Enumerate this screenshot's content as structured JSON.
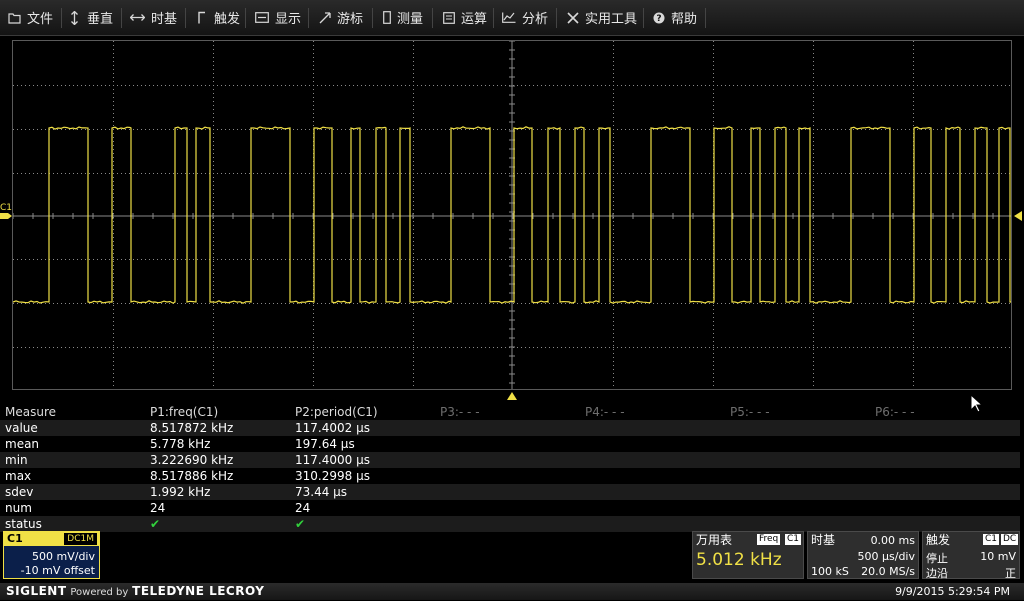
{
  "menu": {
    "items": [
      {
        "label": "文件",
        "icon": "folder-icon"
      },
      {
        "label": "垂直",
        "icon": "vertical-arrows-icon"
      },
      {
        "label": "时基",
        "icon": "horizontal-arrows-icon"
      },
      {
        "label": "触发",
        "icon": "trigger-edge-icon"
      },
      {
        "label": "显示",
        "icon": "display-icon"
      },
      {
        "label": "游标",
        "icon": "cursor-icon"
      },
      {
        "label": "测量",
        "icon": "measure-icon"
      },
      {
        "label": "运算",
        "icon": "math-icon"
      },
      {
        "label": "分析",
        "icon": "analysis-icon"
      },
      {
        "label": "实用工具",
        "icon": "tools-icon"
      },
      {
        "label": "帮助",
        "icon": "help-icon"
      }
    ]
  },
  "scope": {
    "channel_label": "C1",
    "trace_color": "#f0e046",
    "waveform_edges": [
      49,
      88,
      112,
      131,
      175,
      187,
      196,
      210,
      251,
      290,
      314,
      332,
      351,
      360,
      376,
      386,
      400,
      410,
      451,
      490,
      514,
      532,
      548,
      560,
      575,
      584,
      599,
      610,
      651,
      690,
      714,
      732,
      751,
      760,
      775,
      786,
      799,
      810,
      851,
      890,
      914,
      931,
      946,
      960,
      975,
      987,
      999,
      1010
    ]
  },
  "measure": {
    "header": [
      "Measure",
      "P1:freq(C1)",
      "P2:period(C1)",
      "P3:- - -",
      "P4:- - -",
      "P5:- - -",
      "P6:- - -"
    ],
    "rows": [
      {
        "label": "value",
        "p1": "8.517872 kHz",
        "p2": "117.4002 µs"
      },
      {
        "label": "mean",
        "p1": "5.778 kHz",
        "p2": "197.64 µs"
      },
      {
        "label": "min",
        "p1": "3.222690 kHz",
        "p2": "117.4000 µs"
      },
      {
        "label": "max",
        "p1": "8.517886 kHz",
        "p2": "310.2998 µs"
      },
      {
        "label": "sdev",
        "p1": "1.992 kHz",
        "p2": "73.44 µs"
      },
      {
        "label": "num",
        "p1": "24",
        "p2": "24"
      },
      {
        "label": "status",
        "p1": "✔",
        "p2": "✔"
      }
    ]
  },
  "channel1": {
    "name": "C1",
    "coupling": "DC1M",
    "scale": "500 mV/div",
    "offset": "-10 mV offset"
  },
  "dvm": {
    "title": "万用表",
    "mode": "Freq",
    "source": "C1",
    "reading": "5.012 kHz"
  },
  "timebase": {
    "title": "时基",
    "delay": "0.00 ms",
    "scale": "500 µs/div",
    "memory": "100 kS",
    "sample_rate": "20.0 MS/s"
  },
  "trigger": {
    "title": "触发",
    "source": "C1",
    "coupling": "DC",
    "state": "停止",
    "level": "10 mV",
    "edge_type": "边沿",
    "slope": "正"
  },
  "footer": {
    "brand": "SIGLENT",
    "powered": "Powered by",
    "partner": "TELEDYNE LECROY",
    "datetime": "9/9/2015 5:29:54 PM"
  }
}
